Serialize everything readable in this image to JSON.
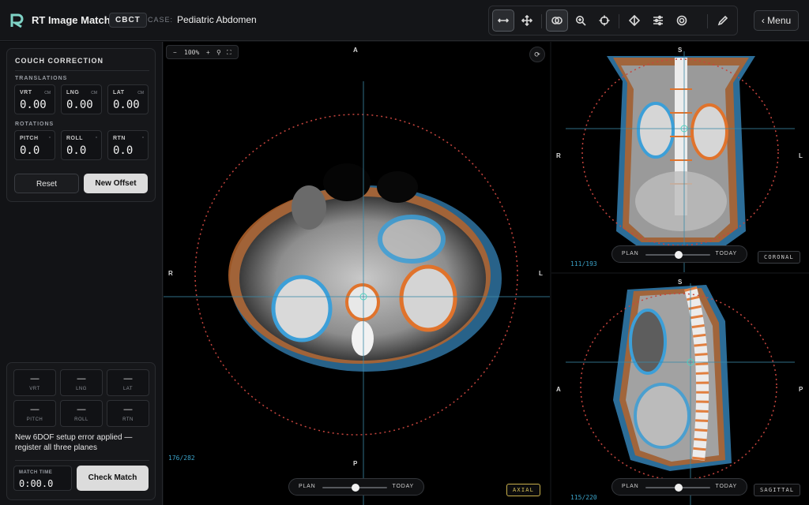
{
  "header": {
    "app_title": "RT Image Match",
    "modality": "CBCT",
    "case_label": "CASE:",
    "case_value": "Pediatric Abdomen",
    "menu_label": "‹ Menu"
  },
  "toolbar": {
    "tools": [
      "swap-icon",
      "move-icon",
      "overlay-icon",
      "zoom-icon",
      "crosshair-icon",
      "window-icon",
      "sliders-icon",
      "target-icon",
      "pen-icon"
    ],
    "active": [
      "swap-icon",
      "overlay-icon"
    ]
  },
  "couch": {
    "title": "COUCH CORRECTION",
    "translations_label": "TRANSLATIONS",
    "translations": [
      {
        "label": "VRT",
        "unit": "CM",
        "value": "0.00"
      },
      {
        "label": "LNG",
        "unit": "CM",
        "value": "0.00"
      },
      {
        "label": "LAT",
        "unit": "CM",
        "value": "0.00"
      }
    ],
    "rotations_label": "ROTATIONS",
    "rotations": [
      {
        "label": "PITCH",
        "unit": "°",
        "value": "0.0"
      },
      {
        "label": "ROLL",
        "unit": "°",
        "value": "0.0"
      },
      {
        "label": "RTN",
        "unit": "°",
        "value": "0.0"
      }
    ],
    "reset_label": "Reset",
    "new_offset_label": "New Offset"
  },
  "setup_error": {
    "cells": [
      {
        "label": "VRT",
        "value": "—"
      },
      {
        "label": "LNG",
        "value": "—"
      },
      {
        "label": "LAT",
        "value": "—"
      },
      {
        "label": "PITCH",
        "value": "—"
      },
      {
        "label": "ROLL",
        "value": "—"
      },
      {
        "label": "RTN",
        "value": "—"
      }
    ],
    "status": "New 6DOF setup error applied — register all three planes",
    "match_time_label": "MATCH TIME",
    "match_time_value": "0:00.0",
    "check_match_label": "Check Match"
  },
  "axial": {
    "zoom": "100%",
    "top": "A",
    "bottom": "P",
    "left": "R",
    "right": "L",
    "slice": "176/282",
    "tag": "AXIAL",
    "blend": {
      "a": "PLAN",
      "b": "TODAY",
      "level": 0.5
    }
  },
  "coronal": {
    "top": "S",
    "left": "R",
    "right": "L",
    "slice": "111/193",
    "tag": "CORONAL",
    "blend": {
      "a": "PLAN",
      "b": "TODAY",
      "level": 0.5
    }
  },
  "sagittal": {
    "top": "S",
    "left": "A",
    "right": "P",
    "slice": "115/220",
    "tag": "SAGITTAL",
    "blend": {
      "a": "PLAN",
      "b": "TODAY",
      "level": 0.5
    }
  },
  "colors": {
    "plan": "#e0732c",
    "today": "#3c9fd8",
    "crosshair": "#3b8aa8",
    "contour": "#c8453e",
    "active_tag": "#c9b04a"
  }
}
